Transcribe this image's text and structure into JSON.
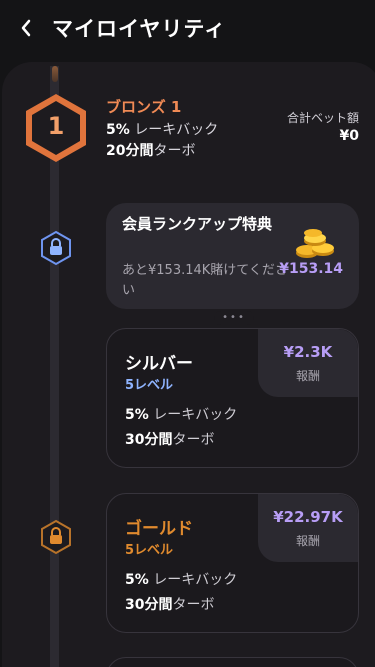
{
  "header": {
    "title": "マイロイヤリティ"
  },
  "current": {
    "rank_number": "1",
    "rank_name": "ブロンズ 1",
    "cashback_value": "5%",
    "cashback_label": "レーキバック",
    "turbo_value": "20分間",
    "turbo_label": "ターボ",
    "total_bet_label": "合計ベット額",
    "total_bet_value": "¥0"
  },
  "rankup": {
    "title": "会員ランクアップ特典",
    "remaining": "あと¥153.14K賭けてください",
    "amount": "¥153.14"
  },
  "tiers": [
    {
      "name": "シルバー",
      "level": "5レベル",
      "reward_value": "¥2.3K",
      "reward_label": "報酬",
      "cashback_value": "5%",
      "cashback_label": "レーキバック",
      "turbo_value": "30分間",
      "turbo_label": "ターボ"
    },
    {
      "name": "ゴールド",
      "level": "5レベル",
      "reward_value": "¥22.97K",
      "reward_label": "報酬",
      "cashback_value": "5%",
      "cashback_label": "レーキバック",
      "turbo_value": "30分間",
      "turbo_label": "ターボ"
    }
  ],
  "colors": {
    "bronze": "#f08a55",
    "silver": "#8fb4ff",
    "gold": "#e08a2e",
    "accent_purple": "#b89ef6"
  },
  "icons": {
    "back": "chevron-left-icon",
    "lock": "lock-icon",
    "coins": "coins-icon"
  }
}
